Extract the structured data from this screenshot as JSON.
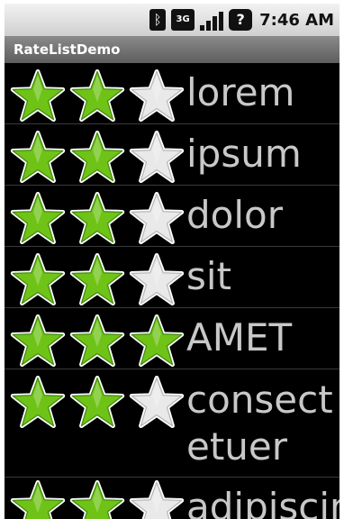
{
  "status_bar": {
    "icons": [
      "bluetooth-icon",
      "3g-icon",
      "signal-icon",
      "sim-alert-icon"
    ],
    "net_label": "3G",
    "sim_label": "?",
    "time": "7:46 AM"
  },
  "app": {
    "title": "RateListDemo"
  },
  "colors": {
    "star_on": "#6fc317",
    "star_off": "#e9e9e9",
    "text": "#c8c8c8"
  },
  "rows": [
    {
      "label": "lorem",
      "rating": [
        true,
        true,
        false
      ]
    },
    {
      "label": "ipsum",
      "rating": [
        true,
        true,
        false
      ]
    },
    {
      "label": "dolor",
      "rating": [
        true,
        true,
        false
      ]
    },
    {
      "label": "sit",
      "rating": [
        true,
        true,
        false
      ]
    },
    {
      "label": "AMET",
      "rating": [
        true,
        true,
        true
      ]
    },
    {
      "label": "consectetuer",
      "label_wrapped": "consect\netuer",
      "rating": [
        true,
        true,
        false
      ]
    },
    {
      "label": "adipiscing",
      "rating": [
        true,
        true,
        false
      ]
    }
  ]
}
